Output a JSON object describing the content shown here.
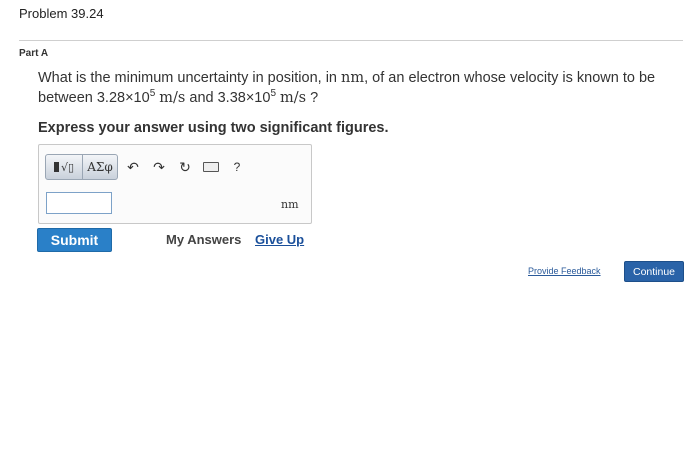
{
  "problem": {
    "title": "Problem 39.24"
  },
  "part": {
    "label": "Part A"
  },
  "question": {
    "text_1": "What is the minimum uncertainty in position, in ",
    "unit_nm": "nm",
    "text_2": ", of an electron whose velocity is known to be between ",
    "v1_mantissa": "3.28×10",
    "v1_exp": "5",
    "velocity_unit": "m/s",
    "text_3": " and ",
    "v2_mantissa": "3.38×10",
    "v2_exp": "5",
    "text_4": " ?"
  },
  "instruction": "Express your answer using two significant figures.",
  "answer": {
    "toolbar": {
      "template_root_symbol": "√▯",
      "symbols_label": "ΑΣφ",
      "undo_icon": "↶",
      "redo_icon": "↷",
      "reset_icon": "↻",
      "help_label": "?"
    },
    "input_value": "",
    "unit": "nm"
  },
  "actions": {
    "submit": "Submit",
    "my_answers": "My Answers",
    "give_up": "Give Up"
  },
  "footer": {
    "feedback": "Provide Feedback",
    "continue": "Continue"
  },
  "colors": {
    "submit_bg": "#2a80c8",
    "continue_bg": "#2a63a8",
    "link": "#1a4f9a"
  }
}
